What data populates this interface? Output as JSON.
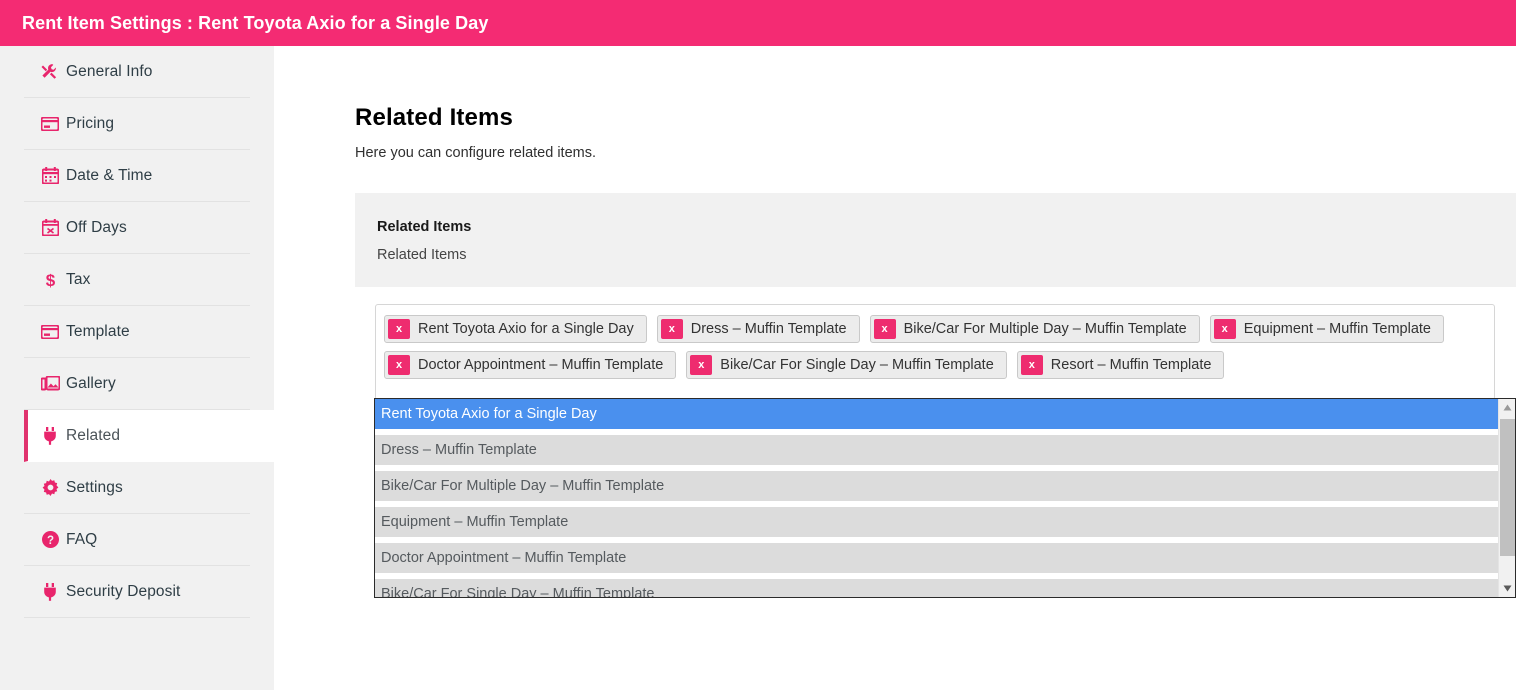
{
  "header": {
    "title": "Rent Item Settings : Rent Toyota Axio for a Single Day",
    "bg_color": "#f42b73"
  },
  "sidebar": {
    "items": [
      {
        "label": "General Info",
        "icon": "tools-icon",
        "active": false
      },
      {
        "label": "Pricing",
        "icon": "credit-card-icon",
        "active": false
      },
      {
        "label": "Date & Time",
        "icon": "calendar-icon",
        "active": false
      },
      {
        "label": "Off Days",
        "icon": "calendar-x-icon",
        "active": false
      },
      {
        "label": "Tax",
        "icon": "dollar-icon",
        "active": false
      },
      {
        "label": "Template",
        "icon": "credit-card-icon",
        "active": false
      },
      {
        "label": "Gallery",
        "icon": "image-icon",
        "active": false
      },
      {
        "label": "Related",
        "icon": "plug-icon",
        "active": true
      },
      {
        "label": "Settings",
        "icon": "gear-icon",
        "active": false
      },
      {
        "label": "FAQ",
        "icon": "question-circle-icon",
        "active": false
      },
      {
        "label": "Security Deposit",
        "icon": "plug-icon",
        "active": false
      }
    ]
  },
  "main": {
    "page_title": "Related Items",
    "page_subtitle": "Here you can configure related items.",
    "panel": {
      "title": "Related Items",
      "subtitle": "Related Items"
    },
    "selected_tags": [
      {
        "label": "Rent Toyota Axio for a Single Day",
        "remove": "x"
      },
      {
        "label": "Dress – Muffin Template",
        "remove": "x"
      },
      {
        "label": "Bike/Car For Multiple Day – Muffin Template",
        "remove": "x"
      },
      {
        "label": "Equipment – Muffin Template",
        "remove": "x"
      },
      {
        "label": "Doctor Appointment – Muffin Template",
        "remove": "x"
      },
      {
        "label": "Bike/Car For Single Day – Muffin Template",
        "remove": "x"
      },
      {
        "label": "Resort – Muffin Template",
        "remove": "x"
      }
    ],
    "dropdown": {
      "options": [
        {
          "label": "Rent Toyota Axio for a Single Day",
          "selected": true
        },
        {
          "label": "Dress – Muffin Template",
          "selected": false
        },
        {
          "label": "Bike/Car For Multiple Day – Muffin Template",
          "selected": false
        },
        {
          "label": "Equipment – Muffin Template",
          "selected": false
        },
        {
          "label": "Doctor Appointment – Muffin Template",
          "selected": false
        },
        {
          "label": "Bike/Car For Single Day – Muffin Template",
          "selected": false
        }
      ],
      "scroll_up": "▲",
      "scroll_down": "▼"
    }
  },
  "colors": {
    "accent": "#f42b73",
    "tag_remove": "#ee2c6f",
    "selection": "#4a90ee",
    "row": "#dcdcdc",
    "sidebar_bg": "#f1f1f1"
  }
}
